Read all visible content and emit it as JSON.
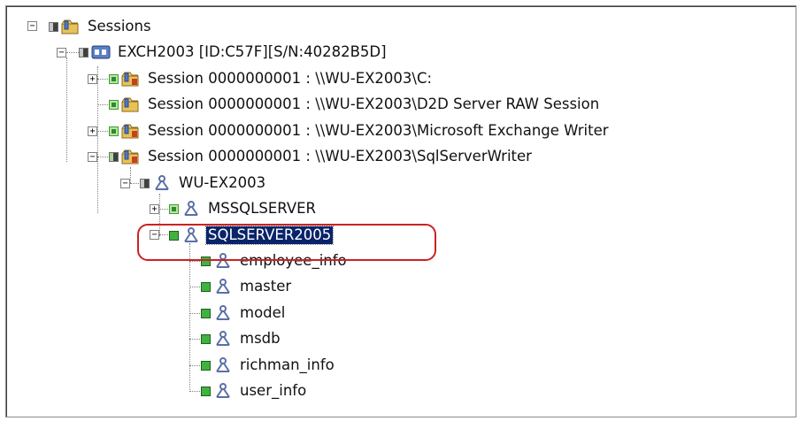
{
  "tree": {
    "root_label": "Sessions",
    "server_label": "EXCH2003 [ID:C57F][S/N:40282B5D]",
    "session_c_label": "Session 0000000001 : \\\\WU-EX2003\\C:",
    "session_d2d_label": "Session 0000000001 : \\\\WU-EX2003\\D2D Server RAW Session",
    "session_exchange_label": "Session 0000000001 : \\\\WU-EX2003\\Microsoft Exchange Writer",
    "session_sql_label": "Session 0000000001 : \\\\WU-EX2003\\SqlServerWriter",
    "host_label": "WU-EX2003",
    "instance_mssql_label": "MSSQLSERVER",
    "instance_sql2005_label": "SQLSERVER2005",
    "databases": [
      "employee_info",
      "master",
      "model",
      "msdb",
      "richman_info",
      "user_info"
    ]
  },
  "colors": {
    "selection": "#0a246a",
    "highlight_ring": "#cc2222",
    "checked": "#3fb23f"
  },
  "icons": [
    "folder-icon",
    "tape-device-icon",
    "session-folder-icon",
    "sql-node-icon"
  ]
}
